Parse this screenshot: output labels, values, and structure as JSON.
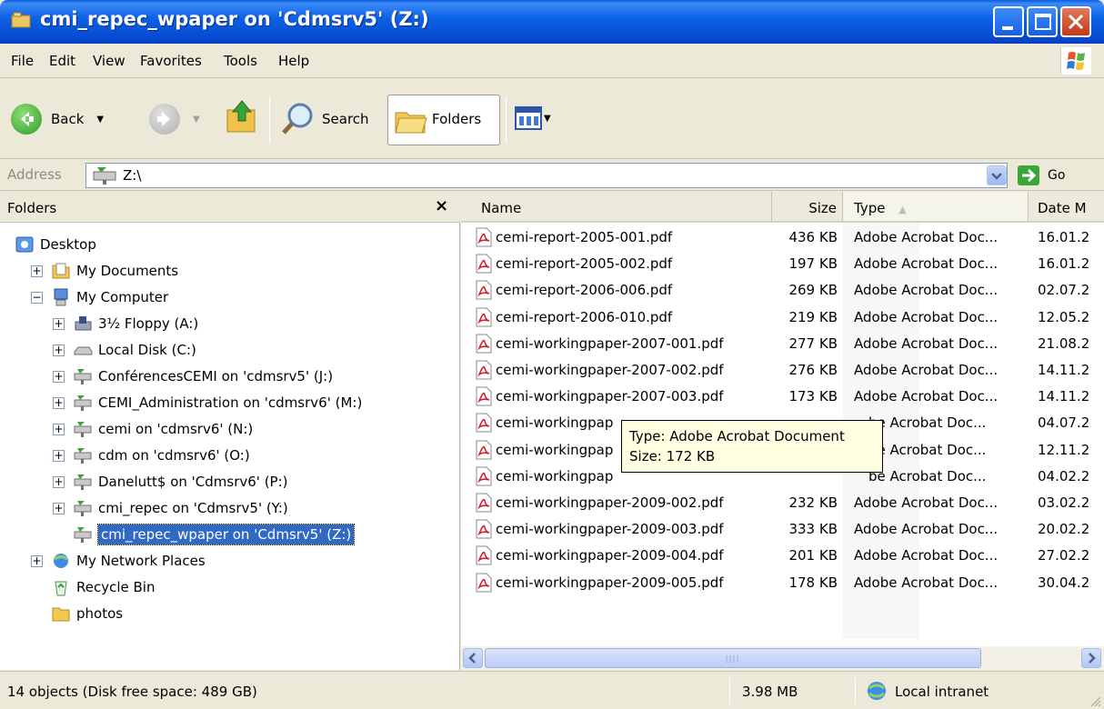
{
  "window": {
    "title": "cmi_repec_wpaper on 'Cdmsrv5' (Z:)"
  },
  "menu": [
    "File",
    "Edit",
    "View",
    "Favorites",
    "Tools",
    "Help"
  ],
  "toolbar": {
    "back": "Back",
    "search": "Search",
    "folders": "Folders"
  },
  "address": {
    "label": "Address",
    "value": "Z:\\",
    "go": "Go"
  },
  "folders_pane": {
    "title": "Folders",
    "close": "×",
    "tree": [
      {
        "label": "Desktop",
        "icon": "desktop-icon",
        "expander": ""
      },
      {
        "label": "My Documents",
        "icon": "my-documents-icon",
        "expander": "+"
      },
      {
        "label": "My Computer",
        "icon": "my-computer-icon",
        "expander": "−"
      },
      {
        "label": "3½ Floppy (A:)",
        "icon": "floppy-icon",
        "expander": "+"
      },
      {
        "label": "Local Disk (C:)",
        "icon": "local-disk-icon",
        "expander": "+"
      },
      {
        "label": "ConférencesCEMI on 'cdmsrv5' (J:)",
        "icon": "network-drive-icon",
        "expander": "+"
      },
      {
        "label": "CEMI_Administration on 'cdmsrv6' (M:)",
        "icon": "network-drive-icon",
        "expander": "+"
      },
      {
        "label": "cemi on 'cdmsrv6' (N:)",
        "icon": "network-drive-icon",
        "expander": "+"
      },
      {
        "label": "cdm on 'cdmsrv6' (O:)",
        "icon": "network-drive-icon",
        "expander": "+"
      },
      {
        "label": "Danelutt$ on 'Cdmsrv6' (P:)",
        "icon": "network-drive-icon",
        "expander": "+"
      },
      {
        "label": "cmi_repec on 'Cdmsrv5' (Y:)",
        "icon": "network-drive-icon",
        "expander": "+"
      },
      {
        "label": "cmi_repec_wpaper on 'Cdmsrv5' (Z:)",
        "icon": "network-drive-icon",
        "expander": ""
      },
      {
        "label": "My Network Places",
        "icon": "network-places-icon",
        "expander": "+"
      },
      {
        "label": "Recycle Bin",
        "icon": "recycle-bin-icon",
        "expander": ""
      },
      {
        "label": "photos",
        "icon": "folder-icon",
        "expander": ""
      }
    ]
  },
  "file_list": {
    "columns": [
      "Name",
      "Size",
      "Type",
      "Date M"
    ],
    "files": [
      {
        "name": "cemi-report-2005-001.pdf",
        "size": "436 KB",
        "type": "Adobe Acrobat Doc...",
        "date": "16.01.2"
      },
      {
        "name": "cemi-report-2005-002.pdf",
        "size": "197 KB",
        "type": "Adobe Acrobat Doc...",
        "date": "16.01.2"
      },
      {
        "name": "cemi-report-2006-006.pdf",
        "size": "269 KB",
        "type": "Adobe Acrobat Doc...",
        "date": "02.07.2"
      },
      {
        "name": "cemi-report-2006-010.pdf",
        "size": "219 KB",
        "type": "Adobe Acrobat Doc...",
        "date": "12.05.2"
      },
      {
        "name": "cemi-workingpaper-2007-001.pdf",
        "size": "277 KB",
        "type": "Adobe Acrobat Doc...",
        "date": "21.08.2"
      },
      {
        "name": "cemi-workingpaper-2007-002.pdf",
        "size": "276 KB",
        "type": "Adobe Acrobat Doc...",
        "date": "14.11.2"
      },
      {
        "name": "cemi-workingpaper-2007-003.pdf",
        "size": "173 KB",
        "type": "Adobe Acrobat Doc...",
        "date": "14.11.2"
      },
      {
        "name": "cemi-workingpap",
        "size": "",
        "type": "be Acrobat Doc...",
        "date": "04.07.2"
      },
      {
        "name": "cemi-workingpap",
        "size": "",
        "type": "be Acrobat Doc...",
        "date": "12.11.2"
      },
      {
        "name": "cemi-workingpap",
        "size": "",
        "type": "be Acrobat Doc...",
        "date": "04.02.2"
      },
      {
        "name": "cemi-workingpaper-2009-002.pdf",
        "size": "232 KB",
        "type": "Adobe Acrobat Doc...",
        "date": "03.02.2"
      },
      {
        "name": "cemi-workingpaper-2009-003.pdf",
        "size": "333 KB",
        "type": "Adobe Acrobat Doc...",
        "date": "20.02.2"
      },
      {
        "name": "cemi-workingpaper-2009-004.pdf",
        "size": "201 KB",
        "type": "Adobe Acrobat Doc...",
        "date": "27.02.2"
      },
      {
        "name": "cemi-workingpaper-2009-005.pdf",
        "size": "178 KB",
        "type": "Adobe Acrobat Doc...",
        "date": "30.04.2"
      }
    ]
  },
  "tooltip": {
    "line1": "Type: Adobe Acrobat Document",
    "line2": "Size: 172 KB"
  },
  "status": {
    "objects": "14 objects (Disk free space: 489 GB)",
    "size": "3.98 MB",
    "zone": "Local intranet"
  }
}
